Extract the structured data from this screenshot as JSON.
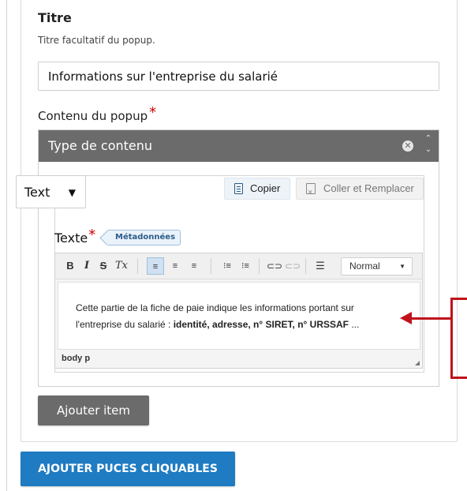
{
  "form": {
    "title_label": "Titre",
    "title_description": "Titre facultatif du popup.",
    "title_value": "Informations sur l'entreprise du salarié",
    "content_label": "Contenu du popup",
    "required_mark": "*"
  },
  "content_panel": {
    "header": "Type de contenu",
    "close_glyph": "✕",
    "arrows_glyph": "⌃\n⌄",
    "type_select": "Text",
    "copy_button": "Copier",
    "paste_button": "Coller et Remplacer",
    "text_label": "Texte",
    "metadata_tag": "Métadonnées"
  },
  "editor": {
    "toolbar": {
      "bold": "B",
      "italic": "I",
      "strike": "S",
      "clear_format": "Tx",
      "align_left": "≡",
      "align_center": "≡",
      "align_right": "≡",
      "bullet_list": "⁝≡",
      "numbered_list": "⁝≡",
      "link": "⊂⊃",
      "unlink": "⊂⊃",
      "hr": "☰",
      "format_value": "Normal"
    },
    "content_line1": "Cette partie de la fiche de paie indique les informations portant sur",
    "content_line2_prefix": "l'entreprise du salarié : ",
    "content_line2_bold": "identité, adresse, n° SIRET, n° URSSAF",
    "content_line2_suffix": " ...",
    "status_path": "body  p"
  },
  "actions": {
    "add_item": "Ajouter item",
    "add_clickable_bullets": "AJOUTER PUCES CLIQUABLES"
  },
  "colors": {
    "header_grey": "#6b6b6b",
    "primary_blue": "#1f7bc2",
    "annotation_red": "#c0121b",
    "required_red": "#cc0000"
  }
}
